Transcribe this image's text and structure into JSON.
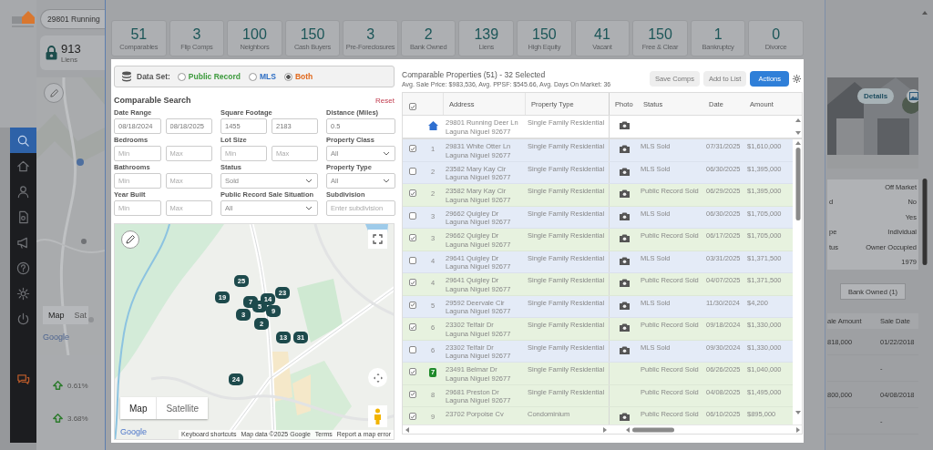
{
  "background": {
    "search": {
      "value": "29801 Running"
    },
    "liens": {
      "count": "913",
      "label": "Liens"
    },
    "map_buttons": [
      {
        "label": "Map",
        "selected": true
      },
      {
        "label": "Sat",
        "selected": false
      }
    ],
    "map_logo": "Google",
    "trends": [
      {
        "value": "0.61%"
      },
      {
        "value": "3.68%"
      }
    ],
    "sidebar": [
      {
        "selected": true
      },
      {
        "selected": false
      },
      {
        "selected": false
      },
      {
        "selected": false
      },
      {
        "selected": false
      },
      {
        "selected": false
      },
      {
        "selected": false
      },
      {
        "selected": false
      }
    ],
    "stats": [
      {
        "value": "51",
        "label": "Comparables"
      },
      {
        "value": "3",
        "label": "Flip Comps"
      },
      {
        "value": "100",
        "label": "Neighbors"
      },
      {
        "value": "150",
        "label": "Cash Buyers"
      },
      {
        "value": "3",
        "label": "Pre-Foreclosures"
      },
      {
        "value": "2",
        "label": "Bank Owned"
      },
      {
        "value": "139",
        "label": "Liens"
      },
      {
        "value": "150",
        "label": "High Equity"
      },
      {
        "value": "41",
        "label": "Vacant"
      },
      {
        "value": "150",
        "label": "Free & Clear"
      },
      {
        "value": "1",
        "label": "Bankruptcy"
      },
      {
        "value": "0",
        "label": "Divorce"
      }
    ],
    "details": {
      "button": "Details",
      "rows": [
        {
          "value": "Off Market"
        },
        {
          "label": "d",
          "value": "No"
        },
        {
          "value": "Yes"
        },
        {
          "label": "pe",
          "value": "Individual"
        },
        {
          "label": "tus",
          "value": "Owner Occupied"
        },
        {
          "value": "1979"
        }
      ]
    },
    "bank_owned_button": "Bank Owned (1)",
    "sales": {
      "columns": [
        "ale Amount",
        "Sale Date"
      ],
      "rows": [
        {
          "amount": "818,000",
          "date": "01/22/2018"
        },
        {
          "date": "-"
        },
        {
          "amount": "800,000",
          "date": "04/08/2018"
        },
        {
          "date": "-"
        }
      ]
    }
  },
  "data_set": {
    "label": "Data Set:",
    "options": [
      {
        "label": "Public Record",
        "selected": false,
        "color": "#3c9a3c"
      },
      {
        "label": "MLS",
        "selected": false,
        "color": "#2f6fc4"
      },
      {
        "label": "Both",
        "selected": true,
        "color": "#e0681c"
      }
    ]
  },
  "search": {
    "title": "Comparable Search",
    "reset": "Reset",
    "filters": [
      {
        "label": "Date Range",
        "kind": "range",
        "inputs": [
          {
            "value": "08/18/2024"
          },
          {
            "value": "08/18/2025"
          }
        ]
      },
      {
        "label": "Square Footage",
        "kind": "range",
        "inputs": [
          {
            "value": "1455"
          },
          {
            "value": "2183"
          }
        ]
      },
      {
        "label": "Distance (Miles)",
        "kind": "text",
        "inputs": [
          {
            "value": "0.5"
          }
        ]
      },
      {
        "label": "Bedrooms",
        "kind": "range",
        "inputs": [
          {
            "placeholder": "Min"
          },
          {
            "placeholder": "Max"
          }
        ]
      },
      {
        "label": "Lot Size",
        "kind": "range",
        "inputs": [
          {
            "placeholder": "Min"
          },
          {
            "placeholder": "Max"
          }
        ]
      },
      {
        "label": "Property Class",
        "kind": "select",
        "value": "All"
      },
      {
        "label": "Bathrooms",
        "kind": "range",
        "inputs": [
          {
            "placeholder": "Min"
          },
          {
            "placeholder": "Max"
          }
        ]
      },
      {
        "label": "Status",
        "kind": "select",
        "value": "Sold"
      },
      {
        "label": "Property Type",
        "kind": "select",
        "value": "All"
      },
      {
        "label": "Year Built",
        "kind": "range",
        "inputs": [
          {
            "placeholder": "Min"
          },
          {
            "placeholder": "Max"
          }
        ]
      },
      {
        "label": "Public Record Sale Situation",
        "kind": "select",
        "value": "All"
      },
      {
        "label": "Subdivision",
        "kind": "text",
        "inputs": [
          {
            "placeholder": "Enter subdivision"
          }
        ]
      }
    ]
  },
  "map": {
    "markers": [
      "25",
      "19",
      "14",
      "23",
      "7",
      "5",
      "9",
      "3",
      "2",
      "13",
      "31",
      "24"
    ],
    "buttons": [
      {
        "label": "Map",
        "selected": true
      },
      {
        "label": "Satellite",
        "selected": false
      }
    ],
    "logo": "Google",
    "attribution": [
      "Keyboard shortcuts",
      "Map data ©2025 Google",
      "Terms",
      "Report a map error"
    ]
  },
  "results": {
    "title": "Comparable Properties (51) - 32 Selected",
    "summary": "Avg. Sale Price: $983,536, Avg. PPSF: $545.66, Avg. Days On Market: 36",
    "buttons": [
      {
        "label": "Save Comps",
        "kind": "secondary"
      },
      {
        "label": "Add to List",
        "kind": "secondary"
      },
      {
        "label": "Actions",
        "kind": "primary"
      }
    ],
    "table": {
      "all_checked": true,
      "columns": [
        "Address",
        "Property Type",
        "Photo",
        "Status",
        "Date",
        "Amount"
      ],
      "subject": {
        "address": [
          "29801 Running Deer Ln",
          "Laguna Niguel 92677"
        ],
        "type": "Single Family Residential",
        "photo": true
      },
      "rows": [
        {
          "number": "1",
          "kind": "plain",
          "checked": true,
          "color": "#e4ebf7",
          "address": [
            "29831 White Otter Ln",
            "Laguna Niguel 92677"
          ],
          "type": "Single Family Residential",
          "photo": true,
          "status": "MLS Sold",
          "date": "07/31/2025",
          "amount": "$1,610,000"
        },
        {
          "number": "2",
          "kind": "plain",
          "checked": false,
          "color": "#e4ebf7",
          "address": [
            "23582 Mary Kay Cir",
            "Laguna Niguel 92677"
          ],
          "type": "Single Family Residential",
          "photo": true,
          "status": "MLS Sold",
          "date": "06/30/2025",
          "amount": "$1,395,000"
        },
        {
          "number": "2",
          "kind": "plain",
          "checked": true,
          "color": "#e7f2df",
          "address": [
            "23582 Mary Kay Cir",
            "Laguna Niguel 92677"
          ],
          "type": "Single Family Residential",
          "photo": true,
          "status": "Public Record Sold",
          "date": "06/29/2025",
          "amount": "$1,395,000"
        },
        {
          "number": "3",
          "kind": "plain",
          "checked": false,
          "color": "#e4ebf7",
          "address": [
            "29662 Quigley Dr",
            "Laguna Niguel 92677"
          ],
          "type": "Single Family Residential",
          "photo": true,
          "status": "MLS Sold",
          "date": "06/30/2025",
          "amount": "$1,705,000"
        },
        {
          "number": "3",
          "kind": "plain",
          "checked": true,
          "color": "#e7f2df",
          "address": [
            "29662 Quigley Dr",
            "Laguna Niguel 92677"
          ],
          "type": "Single Family Residential",
          "photo": true,
          "status": "Public Record Sold",
          "date": "06/17/2025",
          "amount": "$1,705,000"
        },
        {
          "number": "4",
          "kind": "plain",
          "checked": false,
          "color": "#e4ebf7",
          "address": [
            "29641 Quigley Dr",
            "Laguna Niguel 92677"
          ],
          "type": "Single Family Residential",
          "photo": true,
          "status": "MLS Sold",
          "date": "03/31/2025",
          "amount": "$1,371,500"
        },
        {
          "number": "4",
          "kind": "plain",
          "checked": true,
          "color": "#e7f2df",
          "address": [
            "29641 Quigley Dr",
            "Laguna Niguel 92677"
          ],
          "type": "Single Family Residential",
          "photo": true,
          "status": "Public Record Sold",
          "date": "04/07/2025",
          "amount": "$1,371,500"
        },
        {
          "number": "5",
          "kind": "plain",
          "checked": true,
          "color": "#e4ebf7",
          "address": [
            "29592 Deervale Cir",
            "Laguna Niguel 92677"
          ],
          "type": "Single Family Residential",
          "photo": true,
          "status": "MLS Sold",
          "date": "11/30/2024",
          "amount": "$4,200"
        },
        {
          "number": "6",
          "kind": "plain",
          "checked": true,
          "color": "#e7f2df",
          "address": [
            "23302 Telfair Dr",
            "Laguna Niguel 92677"
          ],
          "type": "Single Family Residential",
          "photo": true,
          "status": "Public Record Sold",
          "date": "09/18/2024",
          "amount": "$1,330,000"
        },
        {
          "number": "6",
          "kind": "plain",
          "checked": false,
          "color": "#e4ebf7",
          "address": [
            "23302 Telfair Dr",
            "Laguna Niguel 92677"
          ],
          "type": "Single Family Residential",
          "photo": true,
          "status": "MLS Sold",
          "date": "09/30/2024",
          "amount": "$1,330,000"
        },
        {
          "number": "7",
          "kind": "badge",
          "checked": true,
          "color": "#e7f2df",
          "address": [
            "23491 Belmar Dr",
            "Laguna Niguel 92677"
          ],
          "type": "Single Family Residential",
          "photo": false,
          "status": "Public Record Sold",
          "date": "06/26/2025",
          "amount": "$1,040,000"
        },
        {
          "number": "8",
          "kind": "plain",
          "checked": true,
          "color": "#e7f2df",
          "address": [
            "29681 Preston Dr",
            "Laguna Niguel 92677"
          ],
          "type": "Single Family Residential",
          "photo": false,
          "status": "Public Record Sold",
          "date": "04/08/2025",
          "amount": "$1,495,000"
        },
        {
          "number": "9",
          "kind": "plain",
          "checked": true,
          "color": "#e7f2df",
          "address": [
            "23702 Porpoise Cv"
          ],
          "type": "Condominium",
          "photo": true,
          "status": "Public Record Sold",
          "date": "06/10/2025",
          "amount": "$895,000"
        }
      ]
    }
  }
}
